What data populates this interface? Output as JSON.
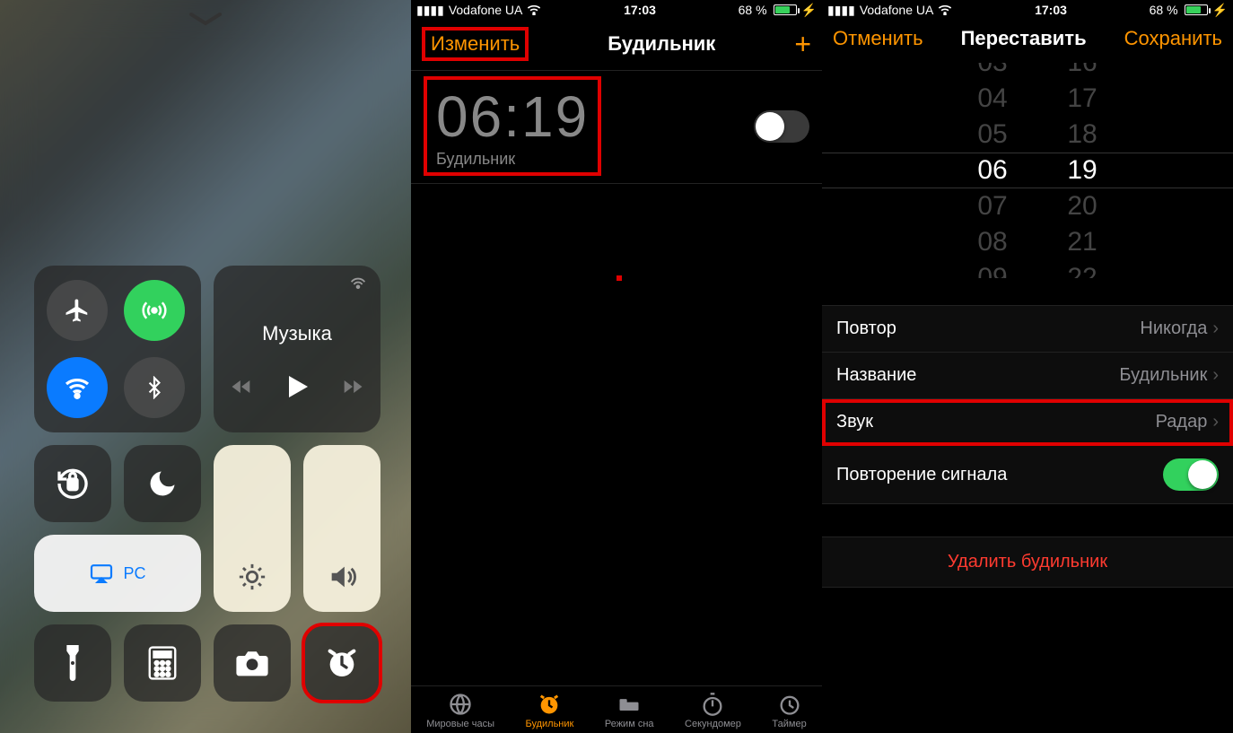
{
  "status": {
    "carrier": "Vodafone UA",
    "time": "17:03",
    "battery_pct": "68 %"
  },
  "panel1": {
    "music_label": "Музыка",
    "pc_label": "PC"
  },
  "panel2": {
    "edit": "Изменить",
    "title": "Будильник",
    "alarm_time": "06:19",
    "alarm_label": "Будильник",
    "tabs": [
      "Мировые часы",
      "Будильник",
      "Режим сна",
      "Секундомер",
      "Таймер"
    ]
  },
  "panel3": {
    "cancel": "Отменить",
    "title": "Переставить",
    "save": "Сохранить",
    "picker_hours": [
      "03",
      "04",
      "05",
      "06",
      "07",
      "08",
      "09"
    ],
    "picker_mins": [
      "16",
      "17",
      "18",
      "19",
      "20",
      "21",
      "22"
    ],
    "rows": {
      "repeat_l": "Повтор",
      "repeat_v": "Никогда",
      "name_l": "Название",
      "name_v": "Будильник",
      "sound_l": "Звук",
      "sound_v": "Радар",
      "snooze_l": "Повторение сигнала"
    },
    "delete": "Удалить будильник"
  }
}
